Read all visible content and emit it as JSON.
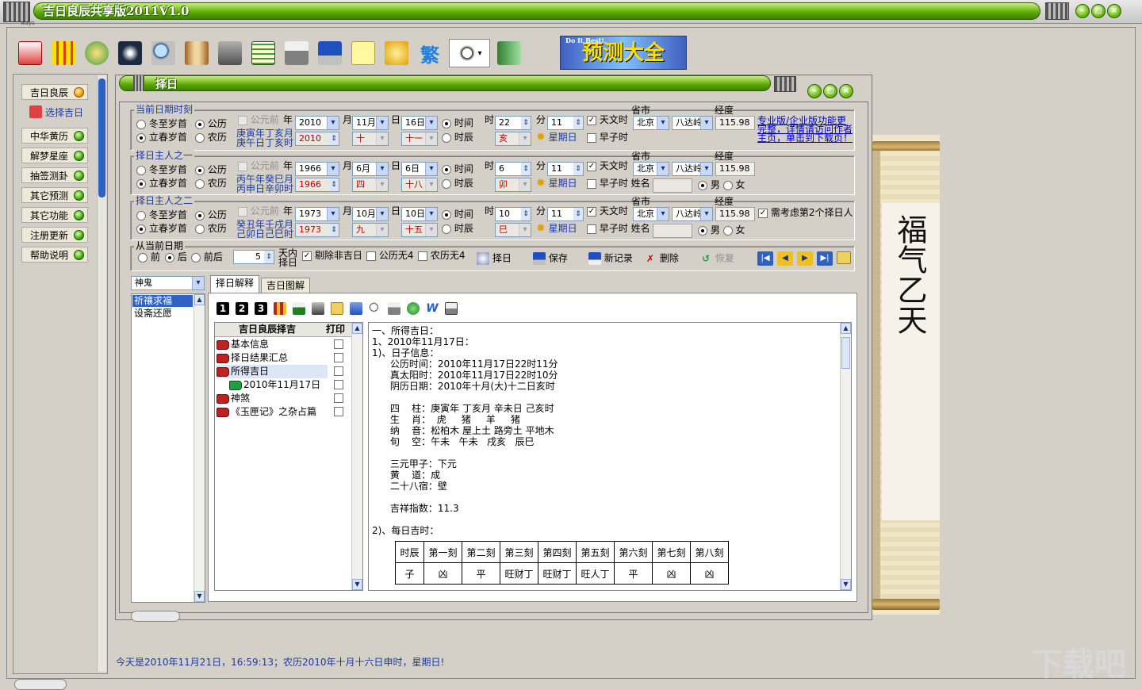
{
  "app": {
    "title": "吉日良辰共享版2011V1.0",
    "sub_title": "择日",
    "mini_label": "ways"
  },
  "toolbar": {
    "buttons": [
      "select-date",
      "calendar",
      "star-sign",
      "fortune",
      "search",
      "book",
      "tools",
      "grid",
      "printer",
      "save",
      "notes",
      "key",
      "traditional",
      "settings",
      "exit"
    ],
    "traditional_label": "繁",
    "banner_text": "预测大全",
    "banner_small": "Do It Best!"
  },
  "sidebar": {
    "items": [
      {
        "label": "吉日良辰",
        "dot": "orange"
      },
      {
        "label": "选择吉日",
        "dot": "none"
      },
      {
        "label": "中华黄历",
        "dot": "green"
      },
      {
        "label": "解梦星座",
        "dot": "green"
      },
      {
        "label": "抽签测卦",
        "dot": "green"
      },
      {
        "label": "其它预测",
        "dot": "green"
      },
      {
        "label": "其它功能",
        "dot": "green"
      },
      {
        "label": "注册更新",
        "dot": "green"
      },
      {
        "label": "帮助说明",
        "dot": "green"
      }
    ]
  },
  "form": {
    "common": {
      "dongzhi": "冬至岁首",
      "lichun": "立春岁首",
      "gongli": "公历",
      "nongli": "农历",
      "gongyuanqian": "公元前",
      "year": "年",
      "month": "月",
      "day": "日",
      "shijian": "时间",
      "shichen": "时辰",
      "shi": "时",
      "fen": "分",
      "tianwenshi": "天文时",
      "zaozishi": "早子时",
      "shengshi": "省市",
      "jingdu": "经度",
      "xingming": "姓名",
      "male": "男",
      "female": "女"
    },
    "current": {
      "title": "当前日期时刻",
      "ganzhi1": "庚寅年丁亥月",
      "ganzhi2": "庚午日丁亥时",
      "year": "2010",
      "month": "11月",
      "day": "16日",
      "lunar_year": "2010",
      "lunar_month": "十",
      "lunar_day": "十一",
      "hour": "22",
      "minute": "11",
      "shichen": "亥",
      "weekday": "星期日",
      "province": "北京",
      "city": "八达岭",
      "longitude": "115.98",
      "promo": [
        "专业版/企业版功能更",
        "完整，详情请访问作者",
        "主页，单击到下载页！"
      ]
    },
    "owner1": {
      "title": "择日主人之一",
      "ganzhi1": "丙午年癸巳月",
      "ganzhi2": "丙申日辛卯时",
      "year": "1966",
      "month": "6月",
      "day": "6日",
      "lunar_year": "1966",
      "lunar_month": "四",
      "lunar_day": "十八",
      "hour": "6",
      "minute": "11",
      "shichen": "卯",
      "weekday": "星期日",
      "province": "北京",
      "city": "八达岭",
      "longitude": "115.98"
    },
    "owner2": {
      "title": "择日主人之二",
      "ganzhi1": "癸丑年壬戌月",
      "ganzhi2": "己卯日己巳时",
      "year": "1973",
      "month": "10月",
      "day": "10日",
      "lunar_year": "1973",
      "lunar_month": "九",
      "lunar_day": "十五",
      "hour": "10",
      "minute": "11",
      "shichen": "巳",
      "weekday": "星期日",
      "province": "北京",
      "city": "八达岭",
      "longitude": "115.98",
      "consider": "需考虑第2个择日人"
    },
    "range": {
      "title": "从当前日期",
      "before": "前",
      "after": "后",
      "both": "前后",
      "days": "5",
      "within_1": "天内",
      "within_2": "择日",
      "remove_bad": "剔除非吉日",
      "gongliwu4": "公历无4",
      "nongliwu4": "农历无4",
      "zeri": "择日",
      "save": "保存",
      "new": "新记录",
      "delete": "删除",
      "restore": "恢复"
    }
  },
  "category": {
    "select": "神鬼",
    "items": [
      "祈禳求福",
      "设斋还愿"
    ]
  },
  "tabs": [
    "择日解释",
    "吉日图解"
  ],
  "tree": {
    "header": "吉日良辰择吉",
    "print_header": "打印",
    "rows": [
      {
        "label": "基本信息",
        "icon": "red"
      },
      {
        "label": "择日结果汇总",
        "icon": "red"
      },
      {
        "label": "所得吉日",
        "icon": "red"
      },
      {
        "label": "2010年11月17日",
        "icon": "green"
      },
      {
        "label": "神煞",
        "icon": "red"
      },
      {
        "label": "《玉匣记》之杂占篇",
        "icon": "red"
      }
    ]
  },
  "result": {
    "lines": [
      "一、所得吉日：",
      "1、2010年11月17日：",
      "1)、日子信息：",
      "      公历时间：2010年11月17日22时11分",
      "      真太阳时：2010年11月17日22时10分",
      "      阴历日期：2010年十月(大)十二日亥时",
      "",
      "      四    柱：庚寅年 丁亥月 辛未日 己亥时",
      "      生    肖：  虎     猪     羊     猪",
      "      纳    音：松柏木 屋上土 路旁土 平地木",
      "      旬    空：午未   午未   戌亥   辰巳",
      "",
      "      三元甲子：下元",
      "      黄    道：成",
      "      二十八宿：壁",
      "",
      "      吉祥指数：11.3",
      "",
      "2)、每日吉时："
    ],
    "table_header": [
      "时辰",
      "第一刻",
      "第二刻",
      "第三刻",
      "第四刻",
      "第五刻",
      "第六刻",
      "第七刻",
      "第八刻"
    ],
    "table_row": [
      "子",
      "凶",
      "平",
      "旺财丁",
      "旺财丁",
      "旺人丁",
      "平",
      "凶",
      "凶"
    ]
  },
  "status": {
    "text": "今天是2010年11月21日，16:59:13；农历2010年十月十六日申时，星期日!"
  },
  "watermark": "下载吧",
  "scroll_text": "福气乙天"
}
